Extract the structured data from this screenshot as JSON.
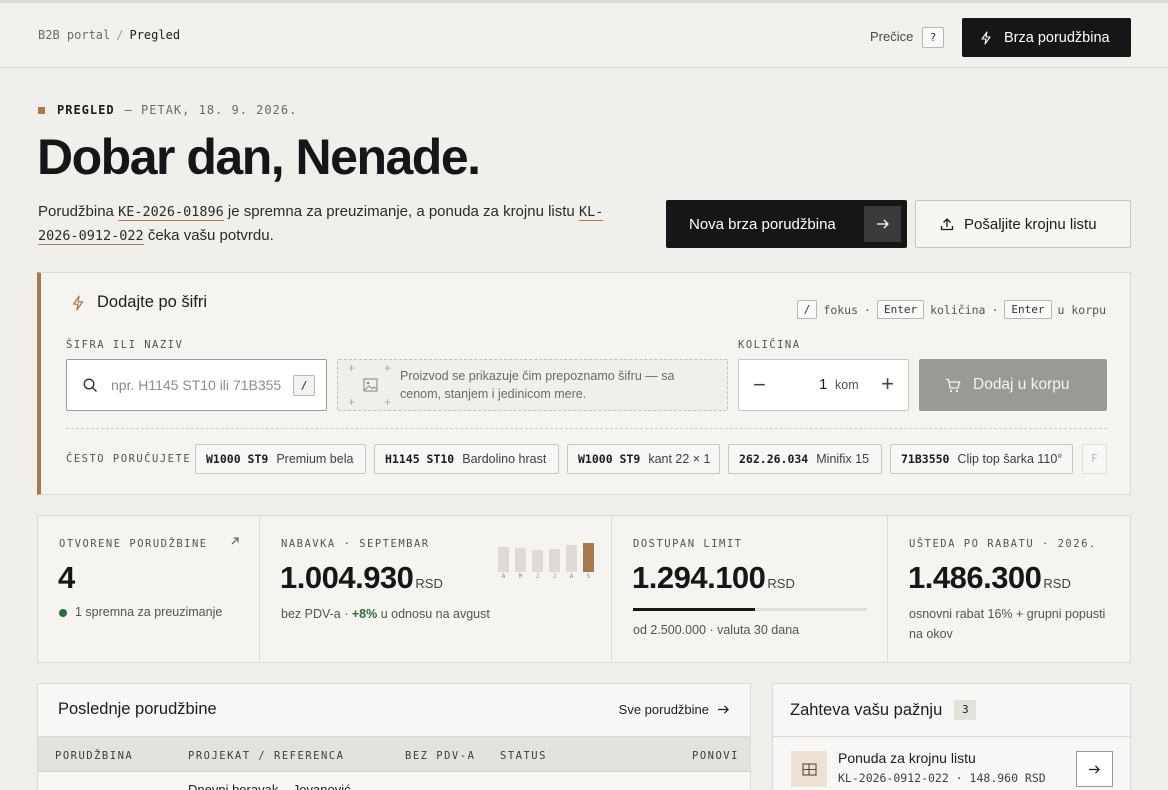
{
  "topbar": {
    "breadcrumb_root": "B2B portal",
    "breadcrumb_sep": "/",
    "breadcrumb_current": "Pregled",
    "shortcuts_label": "Prečice",
    "shortcuts_key": "?",
    "quick_order_label": "Brza porudžbina"
  },
  "hero": {
    "eyebrow": "PREGLED",
    "date": "— PETAK, 18. 9. 2026.",
    "greeting": "Dobar dan, Nenade.",
    "text_1": "Porudžbina ",
    "order_code": "KE-2026-01896",
    "text_2": " je spremna za preuzimanje, a ponuda za krojnu listu ",
    "offer_code": "KL-2026-0912-022",
    "text_3": " čeka vašu potvrdu.",
    "new_order_label": "Nova brza porudžbina",
    "send_list_label": "Pošaljite krojnu listu"
  },
  "quick_add": {
    "title": "Dodajte po šifri",
    "shortcut_slash": "/",
    "shortcut_slash_text": "fokus",
    "shortcut_enter1": "Enter",
    "shortcut_enter1_text": "količina",
    "shortcut_enter2": "Enter",
    "shortcut_enter2_text": "u korpu",
    "dot": "·",
    "code_label": "ŠIFRA ILI NAZIV",
    "code_placeholder": "npr. H1145 ST10 ili 71B355",
    "code_key": "/",
    "preview_text": "Proizvod se prikazuje čim prepoznamo šifru — sa cenom, stanjem i jedinicom mere.",
    "qty_label": "KOLIČINA",
    "qty_value": "1",
    "qty_unit": "kom",
    "add_label": "Dodaj u korpu",
    "frequent_label": "ČESTO PORUČUJETE",
    "frequent": [
      {
        "code": "W1000 ST9",
        "name": "Premium bela"
      },
      {
        "code": "H1145 ST10",
        "name": "Bardolino hrast"
      },
      {
        "code": "W1000 ST9",
        "name": "kant 22 × 1"
      },
      {
        "code": "262.26.034",
        "name": "Minifix 15"
      },
      {
        "code": "71B3550",
        "name": "Clip top šarka 110°"
      }
    ],
    "frequent_more": "F"
  },
  "stats": {
    "open": {
      "label": "OTVORENE PORUDŽBINE",
      "value": "4",
      "sub": "1 spremna za preuzimanje"
    },
    "purchase": {
      "label": "NABAVKA · SEPTEMBAR",
      "value": "1.004.930",
      "unit": "RSD",
      "sub_1": "bez PDV-a · ",
      "sub_change": "+8%",
      "sub_2": " u odnosu na avgust",
      "months": [
        "A",
        "M",
        "J",
        "J",
        "A",
        "S"
      ],
      "levels": [
        0.74,
        0.7,
        0.66,
        0.68,
        0.8,
        0.85
      ]
    },
    "limit": {
      "label": "DOSTUPAN LIMIT",
      "value": "1.294.100",
      "unit": "RSD",
      "sub": "od 2.500.000 · valuta 30 dana",
      "fraction": 0.52
    },
    "savings": {
      "label": "UŠTEDA PO RABATU · 2026.",
      "value": "1.486.300",
      "unit": "RSD",
      "sub": "osnovni rabat 16% + grupni popusti na okov"
    }
  },
  "orders": {
    "title": "Poslednje porudžbine",
    "all_label": "Sve porudžbine",
    "columns": [
      "PORUDŽBINA",
      "PROJEKAT / REFERENCA",
      "BEZ PDV-A",
      "STATUS",
      "PONOVI"
    ],
    "first_row_project": "Dnevni boravak – Jovanović"
  },
  "attention": {
    "title": "Zahteva vašu pažnju",
    "count": "3",
    "item_title": "Ponuda za krojnu listu",
    "item_sub": "KL-2026-0912-022 · 148.960 RSD"
  }
}
